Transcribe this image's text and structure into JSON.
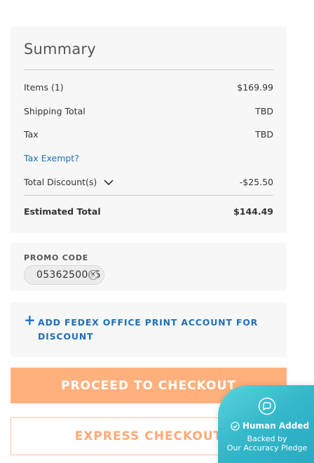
{
  "summary": {
    "title": "Summary",
    "items_label": "Items (1)",
    "items_value": "$169.99",
    "shipping_label": "Shipping Total",
    "shipping_value": "TBD",
    "tax_label": "Tax",
    "tax_value": "TBD",
    "tax_exempt_link": "Tax Exempt?",
    "discount_label": "Total Discount(s)",
    "discount_value": "-$25.50",
    "estimated_label": "Estimated Total",
    "estimated_value": "$144.49"
  },
  "promo": {
    "label": "PROMO CODE",
    "code": "0536250065"
  },
  "fedex": {
    "label": "ADD FEDEX OFFICE PRINT ACCOUNT FOR DISCOUNT"
  },
  "buttons": {
    "checkout": "PROCEED TO CHECKOUT",
    "express": "EXPRESS CHECKOUT"
  },
  "badge": {
    "title": "Human Added",
    "line1": "Backed by",
    "line2": "Our Accuracy Pledge"
  },
  "icons": {
    "discount_toggle": "chevron-down-icon",
    "promo_remove": "close-circle-icon",
    "add_account": "plus-icon",
    "badge_logo": "chat-bubble-icon",
    "badge_check": "check-circle-icon"
  },
  "colors": {
    "link": "#1f6fb5",
    "checkout_bg": "#ffb07c",
    "express_text": "#ffa976",
    "badge_bg": "#33b7c9"
  }
}
